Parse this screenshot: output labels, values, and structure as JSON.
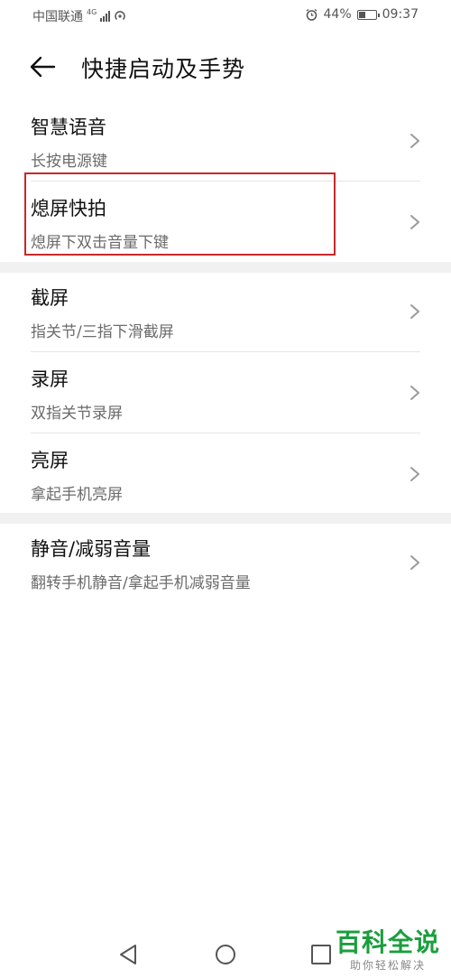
{
  "status_bar": {
    "carrier": "中国联通",
    "network_gen": "4G",
    "battery": "44%",
    "battery_level": 0.44,
    "time": "09:37"
  },
  "header": {
    "title": "快捷启动及手势"
  },
  "groups": [
    {
      "items": [
        {
          "title": "智慧语音",
          "subtitle": "长按电源键"
        },
        {
          "title": "熄屏快拍",
          "subtitle": "熄屏下双击音量下键"
        }
      ]
    },
    {
      "items": [
        {
          "title": "截屏",
          "subtitle": "指关节/三指下滑截屏"
        },
        {
          "title": "录屏",
          "subtitle": "双指关节录屏"
        },
        {
          "title": "亮屏",
          "subtitle": "拿起手机亮屏"
        }
      ]
    },
    {
      "items": [
        {
          "title": "静音/减弱音量",
          "subtitle": "翻转手机静音/拿起手机减弱音量"
        }
      ]
    }
  ],
  "watermark": {
    "title": "百科全说",
    "subtitle": "助你轻松解决"
  },
  "icons": {
    "back": "arrow-left-icon",
    "chevron": "chevron-right-icon",
    "nav_back": "triangle-back-icon",
    "nav_home": "circle-home-icon",
    "nav_recent": "square-recent-icon",
    "alarm": "alarm-clock-icon",
    "hotspot": "hotspot-icon",
    "signal": "signal-bars-icon",
    "battery": "battery-icon"
  },
  "colors": {
    "highlight": "#c62828",
    "watermark_green": "#1b9e3e"
  }
}
